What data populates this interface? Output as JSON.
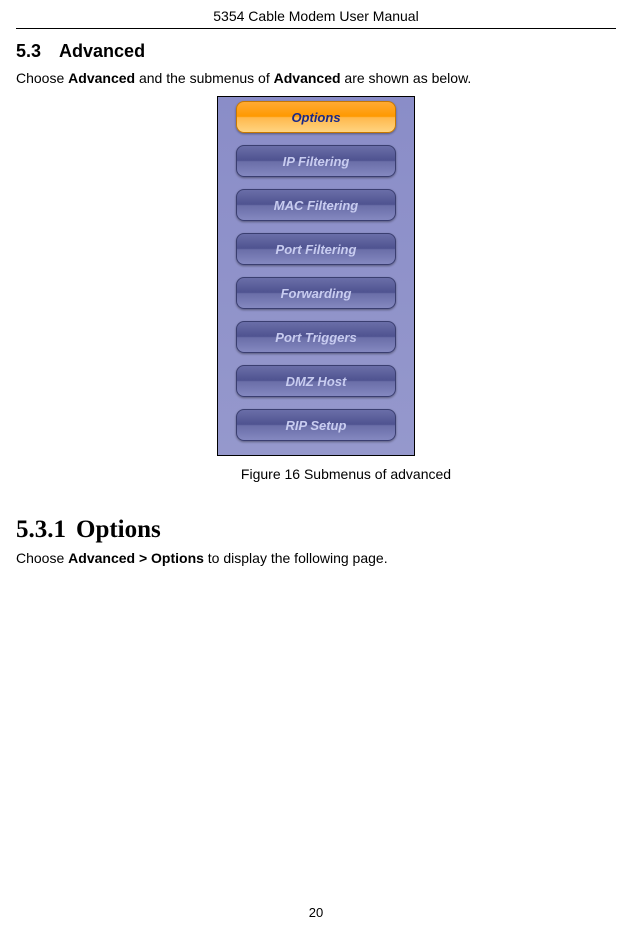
{
  "header": {
    "title": "5354 Cable Modem User Manual"
  },
  "section53": {
    "number": "5.3",
    "title": "Advanced",
    "intro_pre": "Choose ",
    "intro_bold1": "Advanced",
    "intro_mid": " and the submenus of ",
    "intro_bold2": "Advanced",
    "intro_post": " are shown as below."
  },
  "menu": {
    "items": [
      {
        "label": "Options",
        "active": true
      },
      {
        "label": "IP Filtering",
        "active": false
      },
      {
        "label": "MAC Filtering",
        "active": false
      },
      {
        "label": "Port Filtering",
        "active": false
      },
      {
        "label": "Forwarding",
        "active": false
      },
      {
        "label": "Port Triggers",
        "active": false
      },
      {
        "label": "DMZ Host",
        "active": false
      },
      {
        "label": "RIP Setup",
        "active": false
      }
    ]
  },
  "figure": {
    "caption": "Figure 16 Submenus of advanced"
  },
  "section531": {
    "number": "5.3.1",
    "title": "Options",
    "intro_pre": "Choose ",
    "intro_bold": "Advanced > Options",
    "intro_post": " to display the following page."
  },
  "page_number": "20"
}
